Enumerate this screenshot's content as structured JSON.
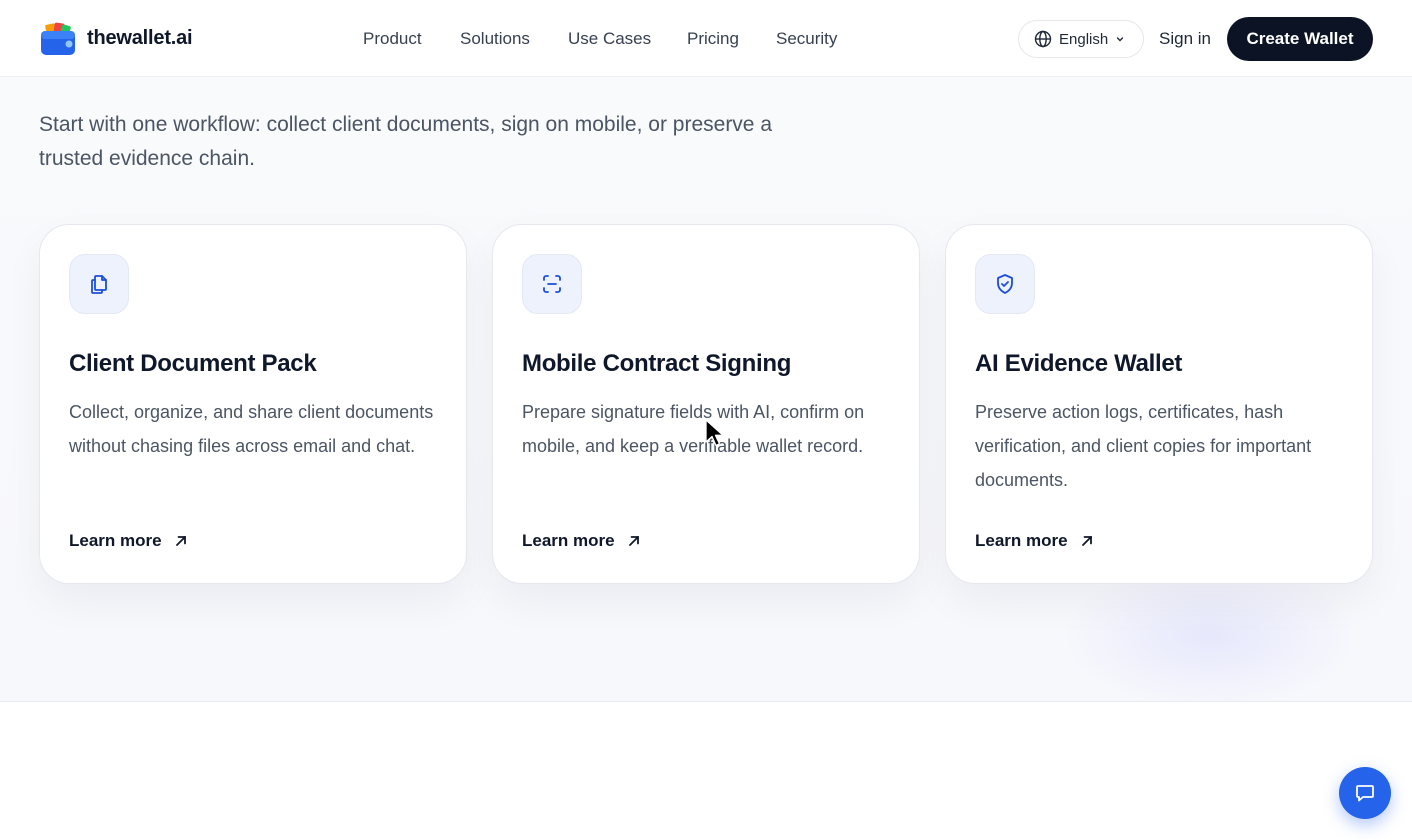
{
  "header": {
    "brand": "thewallet.ai",
    "nav": [
      "Product",
      "Solutions",
      "Use Cases",
      "Pricing",
      "Security"
    ],
    "language": "English",
    "sign_in": "Sign in",
    "cta": "Create Wallet"
  },
  "intro": "Start with one workflow: collect client documents, sign on mobile, or preserve a trusted evidence chain.",
  "cards": [
    {
      "icon": "documents-icon",
      "title": "Client Document Pack",
      "description": "Collect, organize, and share client documents without chasing files across email and chat.",
      "link": "Learn more"
    },
    {
      "icon": "scan-icon",
      "title": "Mobile Contract Signing",
      "description": "Prepare signature fields with AI, confirm on mobile, and keep a verifiable wallet record.",
      "link": "Learn more"
    },
    {
      "icon": "shield-check-icon",
      "title": "AI Evidence Wallet",
      "description": "Preserve action logs, certificates, hash verification, and client copies for important documents.",
      "link": "Learn more"
    }
  ],
  "colors": {
    "primary": "#0b1324",
    "accent": "#2563eb",
    "icon_bg": "#eef2fc"
  }
}
